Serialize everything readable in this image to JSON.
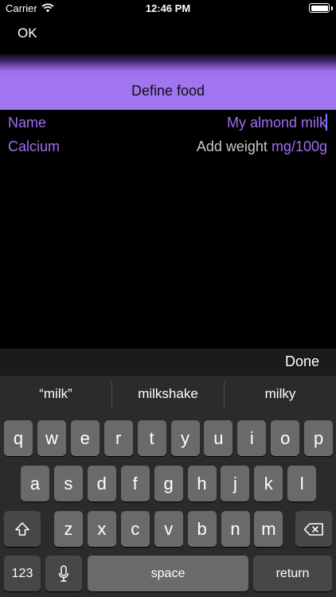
{
  "status_bar": {
    "carrier": "Carrier",
    "time": "12:46 PM",
    "wifi_icon": "wifi-icon",
    "battery_icon": "battery-icon",
    "battery_level": 1.0
  },
  "nav": {
    "ok_label": "OK"
  },
  "header": {
    "title": "Define food",
    "accent_color": "#a174f0"
  },
  "form": {
    "name": {
      "label": "Name",
      "value": "My almond milk"
    },
    "calcium": {
      "label": "Calcium",
      "placeholder": "Add weight",
      "unit": "mg/100g"
    }
  },
  "keyboard": {
    "done_label": "Done",
    "suggestions": [
      "“milk”",
      "milkshake",
      "milky"
    ],
    "row1": [
      "q",
      "w",
      "e",
      "r",
      "t",
      "y",
      "u",
      "i",
      "o",
      "p"
    ],
    "row2": [
      "a",
      "s",
      "d",
      "f",
      "g",
      "h",
      "j",
      "k",
      "l"
    ],
    "row3": [
      "z",
      "x",
      "c",
      "v",
      "b",
      "n",
      "m"
    ],
    "numbers_label": "123",
    "space_label": "space",
    "return_label": "return",
    "shift_icon": "shift-icon",
    "backspace_icon": "backspace-icon",
    "mic_icon": "microphone-icon"
  }
}
